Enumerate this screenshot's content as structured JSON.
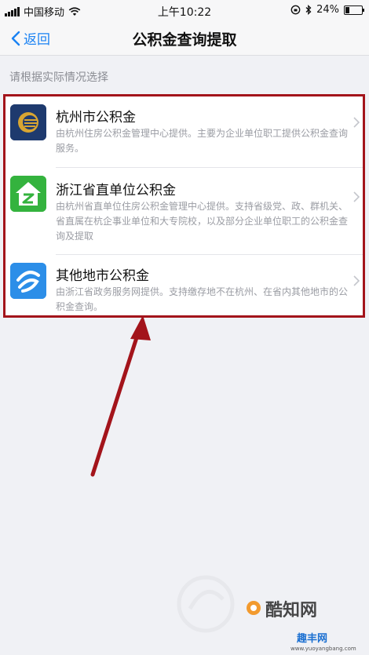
{
  "status_bar": {
    "carrier": "中国移动",
    "time": "上午10:22",
    "battery": "24%",
    "battery_level": 0.24
  },
  "nav": {
    "back_label": "返回",
    "title": "公积金查询提取"
  },
  "hint": "请根据实际情况选择",
  "items": [
    {
      "title": "杭州市公积金",
      "desc": "由杭州住房公积金管理中心提供。主要为企业单位职工提供公积金查询服务。",
      "icon": "hangzhou-fund-logo"
    },
    {
      "title": "浙江省直单位公积金",
      "desc": "由杭州省直单位住房公积金管理中心提供。支持省级党、政、群机关、省直属在杭企事业单位和大专院校，以及部分企业单位职工的公积金查询及提取",
      "icon": "zhejiang-fund-logo"
    },
    {
      "title": "其他地市公积金",
      "desc": "由浙江省政务服务网提供。支持缴存地不在杭州、在省内其他地市的公积金查询。",
      "icon": "zhejiang-gov-logo"
    }
  ],
  "watermark": {
    "brand": "酷知网",
    "site": "趣丰网",
    "url": "www.yuoyangbang.com"
  },
  "colors": {
    "accent": "#1a82f3",
    "highlight": "#a3141b"
  }
}
